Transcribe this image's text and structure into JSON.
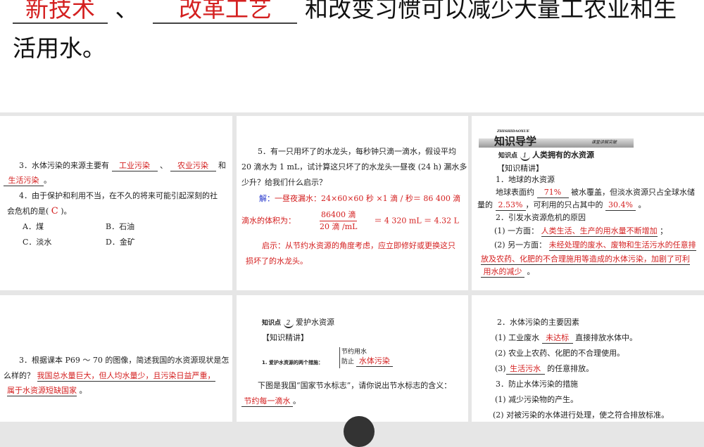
{
  "top": {
    "blank1": "新技术",
    "sep": "、",
    "blank2": "改革工艺",
    "rest": "和改变习惯可以减少大量工农业和生",
    "line2": "活用水。"
  },
  "p1": {
    "q3_a": "3．水体污染的来源主要有",
    "q3_b1": "工业污染",
    "q3_sep": "、",
    "q3_b2": "农业污染",
    "q3_and": "和",
    "q3_b3": "生活污染",
    "q3_end": "。",
    "q4_a": "4．由于保护和利用不当，在不久的将来可能引起深刻的社",
    "q4_b": "会危机的是(",
    "q4_ans": "C",
    "q4_c": ")。",
    "options": [
      "A．煤",
      "B．石油",
      "C．淡水",
      "D．金矿"
    ]
  },
  "p2": {
    "q5_l1": "5．有一只用坏了的水龙头，每秒钟只滴一滴水，假设平均",
    "q5_l2": "20 滴水为 1 mL，试计算这只坏了的水龙头一昼夜 (24 h) 漏水多",
    "q5_l3": "少升？给我们什么启示？",
    "sol_label": "解：",
    "sol_l1": "一昼夜漏水：24×60×60 秒 ×1 滴 / 秒＝ 86 400 滴",
    "sol_l2": "滴水的体积为：",
    "frac_num": "86400 滴",
    "frac_den": "20 滴 /mL",
    "sol_res": "＝ 4 320 mL ＝ 4.32 L",
    "hint_l1": "启示：从节约水资源的角度考虑，应立即修好或更换这只",
    "hint_l2": "损坏了的水龙头。"
  },
  "p3": {
    "banner_sub": "ZHISHIDAOXUE",
    "banner": "知识导学",
    "banner_right": "课堂讲解突破",
    "kp_label": "知识点",
    "kp_num": "1",
    "kp_title": "人类拥有的水资源",
    "section": "【知识精讲】",
    "h1": "1．地球的水资源",
    "l1a": "地球表面约",
    "b71": "71%",
    "l1b": "被水覆盖，但淡水资源只占全球水储",
    "l2a": "量的",
    "b253": "2.53%",
    "l2b": "，可利用的只占其中的",
    "b304": "30.4%",
    "l2c": "。",
    "h2": "2．引发水资源危机的原因",
    "r1a": "(1) 一方面：",
    "r1b": "人类生活、生产的用水量不断增加",
    "r1c": "；",
    "r2a": "(2) 另一方面：",
    "r2b": "未经处理的废水、废物和生活污水的任意排",
    "r2c": "放及农药、化肥的不合理施用等造成的水体污染，加剧了可利",
    "r2d": "用水的减少",
    "r2e": "。"
  },
  "p4": {
    "l1": "3．根据课本 P69 ～ 70 的图像，简述我国的水资源现状是怎",
    "l2a": "么样的？",
    "l2b": "我国总水量巨大，但人均水量少，且污染日益严重，",
    "l3a": "属于水资源短缺国家",
    "l3b": "。"
  },
  "p5": {
    "kp_label": "知识点",
    "kp_num": "2",
    "kp_title": "爱护水资源",
    "section": "【知识精讲】",
    "m_label": "1. 爱护水资源的两个措施：",
    "m1": "节约用水",
    "m2a": "防止",
    "m2b": "水体污染",
    "q_l1": "下图是我国“国家节水标志”，请你说出节水标志的含义：",
    "q_ans": "节约每一滴水",
    "q_end": "。"
  },
  "p6": {
    "h2": "2．水体污染的主要因素",
    "f1a": "(1) 工业废水",
    "f1b": "未达标",
    "f1c": "直接排放水体中。",
    "f2": "(2) 农业上农药、化肥的不合理使用。",
    "f3a": "(3)",
    "f3b": "生活污水",
    "f3c": "的任意排放。",
    "h3": "3．防止水体污染的措施",
    "m1": "(1) 减少污染物的产生。",
    "m2": "(2) 对被污染的水体进行处理，使之符合排放标准。"
  }
}
